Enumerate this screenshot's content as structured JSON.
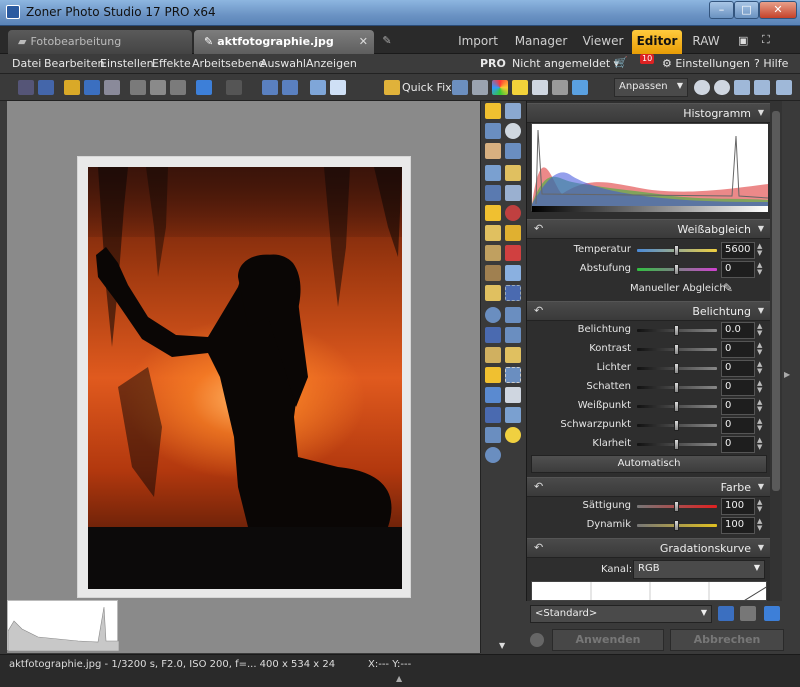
{
  "window": {
    "title": "Zoner Photo Studio 17 PRO x64",
    "minimize": "–",
    "maximize": "□",
    "close": "✕"
  },
  "tabs": [
    {
      "label": "Fotobearbeitung"
    },
    {
      "label": "aktfotographie.jpg",
      "close": "✕"
    }
  ],
  "modes": {
    "import": "Import",
    "manager": "Manager",
    "viewer": "Viewer",
    "editor": "Editor",
    "raw": "RAW"
  },
  "menu": {
    "items": [
      "Datei",
      "Bearbeiten",
      "Einstellen",
      "Effekte",
      "Arbeitsebene",
      "Auswahl",
      "Anzeigen"
    ],
    "pro": "PRO",
    "login": "Nicht angemeldet ▾",
    "badge": "10",
    "settings": "⚙ Einstellungen",
    "help": "? Hilfe"
  },
  "toolbar": {
    "quickfix": "Quick Fix",
    "fit_select": "Anpassen"
  },
  "panel": {
    "histogram": {
      "title": "Histogramm"
    },
    "whitebalance": {
      "title": "Weißabgleich",
      "rows": [
        {
          "label": "Temperatur",
          "value": "5600",
          "pos": 0.5,
          "track": "linear-gradient(90deg,#4a8ad8,#f0d040)"
        },
        {
          "label": "Abstufung",
          "value": "0",
          "pos": 0.5,
          "track": "linear-gradient(90deg,#30c040,#d040d0)"
        }
      ],
      "manual": "Manueller Abgleich"
    },
    "exposure": {
      "title": "Belichtung",
      "rows": [
        {
          "label": "Belichtung",
          "value": "0.0",
          "pos": 0.5
        },
        {
          "label": "Kontrast",
          "value": "0",
          "pos": 0.5
        },
        {
          "label": "Lichter",
          "value": "0",
          "pos": 0.5
        },
        {
          "label": "Schatten",
          "value": "0",
          "pos": 0.5
        },
        {
          "label": "Weißpunkt",
          "value": "0",
          "pos": 0.5
        },
        {
          "label": "Schwarzpunkt",
          "value": "0",
          "pos": 0.5
        },
        {
          "label": "Klarheit",
          "value": "0",
          "pos": 0.5
        }
      ],
      "auto": "Automatisch"
    },
    "color": {
      "title": "Farbe",
      "rows": [
        {
          "label": "Sättigung",
          "value": "100",
          "pos": 0.5,
          "track": "linear-gradient(90deg,#777,#e02020)"
        },
        {
          "label": "Dynamik",
          "value": "100",
          "pos": 0.5,
          "track": "linear-gradient(90deg,#777,#e0c020)"
        }
      ]
    },
    "curves": {
      "title": "Gradationskurve",
      "channel_label": "Kanal:",
      "channel": "RGB"
    }
  },
  "preset": "<Standard>",
  "actions": {
    "apply": "Anwenden",
    "cancel": "Abbrechen"
  },
  "status": {
    "file": "aktfotographie.jpg - 1/3200 s, F2.0, ISO 200, f=... 400 x 534 x 24",
    "coords": "X:--- Y:---"
  },
  "colors": {
    "accent": "#f2b21b",
    "panel_bg": "#2e2e2e",
    "canvas_bg": "#8a8a8a"
  }
}
